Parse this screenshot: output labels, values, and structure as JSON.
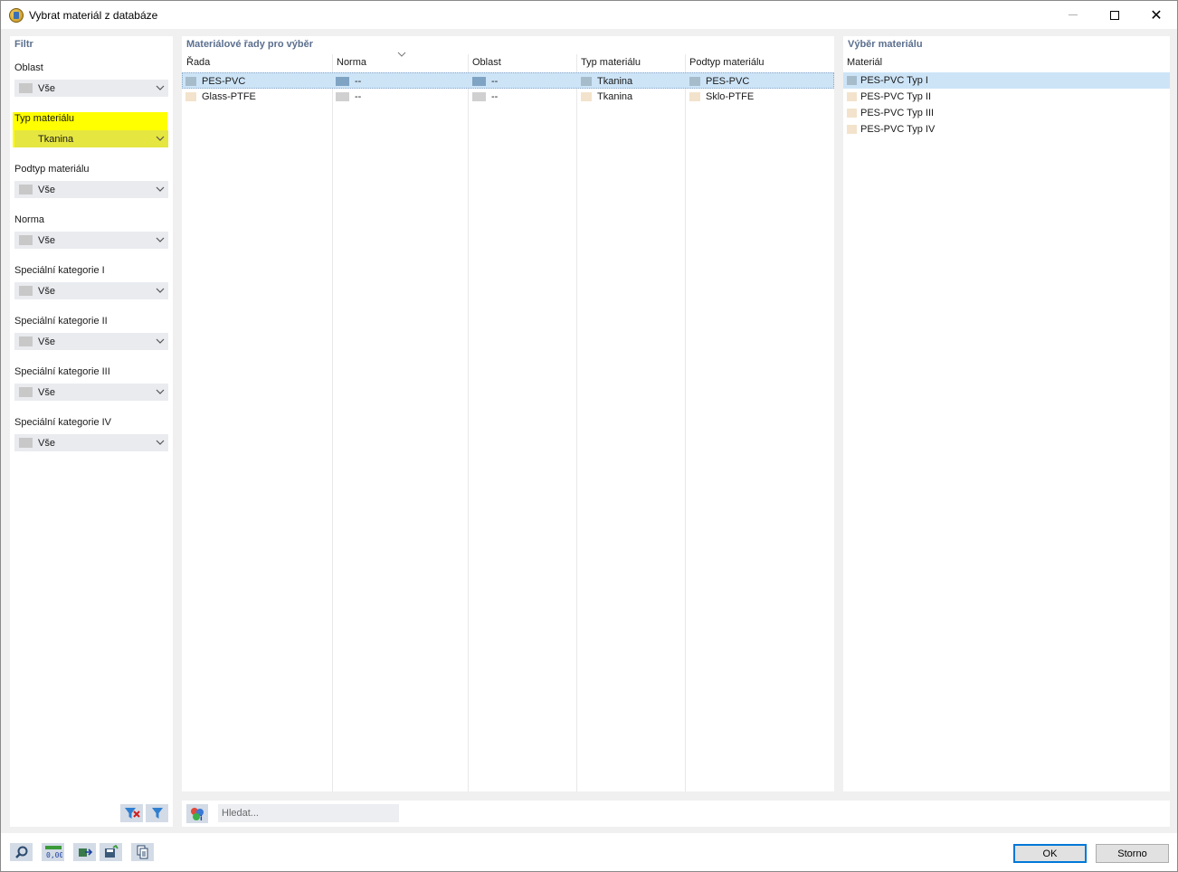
{
  "window": {
    "title": "Vybrat materiál z databáze"
  },
  "filter": {
    "header": "Filtr",
    "groups": [
      {
        "label": "Oblast",
        "value": "Vše"
      },
      {
        "label": "Typ materiálu",
        "value": "Tkanina"
      },
      {
        "label": "Podtyp materiálu",
        "value": "Vše"
      },
      {
        "label": "Norma",
        "value": "Vše"
      },
      {
        "label": "Speciální kategorie I",
        "value": "Vše"
      },
      {
        "label": "Speciální kategorie II",
        "value": "Vše"
      },
      {
        "label": "Speciální kategorie III",
        "value": "Vše"
      },
      {
        "label": "Speciální kategorie IV",
        "value": "Vše"
      }
    ],
    "highlight_color": "#ffff00"
  },
  "series": {
    "header": "Materiálové řady pro výběr",
    "columns": [
      "Řada",
      "Norma",
      "Oblast",
      "Typ materiálu",
      "Podtyp materiálu"
    ],
    "rows": [
      {
        "rada": "PES-PVC",
        "norma": "--",
        "oblast": "--",
        "typ": "Tkanina",
        "podtyp": "PES-PVC"
      },
      {
        "rada": "Glass-PTFE",
        "norma": "--",
        "oblast": "--",
        "typ": "Tkanina",
        "podtyp": "Sklo-PTFE"
      }
    ]
  },
  "materials": {
    "header": "Výběr materiálu",
    "column": "Materiál",
    "items": [
      "PES-PVC Typ I",
      "PES-PVC Typ II",
      "PES-PVC Typ III",
      "PES-PVC Typ IV"
    ]
  },
  "search": {
    "placeholder": "Hledat..."
  },
  "buttons": {
    "ok": "OK",
    "cancel": "Storno"
  },
  "colors": {
    "selection": "#cde4f7",
    "header_text": "#5b6f8e",
    "swatch_fabric": "#f3e3cc",
    "swatch_pvc": "#a6bccb",
    "swatch_gray": "#d0d0d0"
  }
}
